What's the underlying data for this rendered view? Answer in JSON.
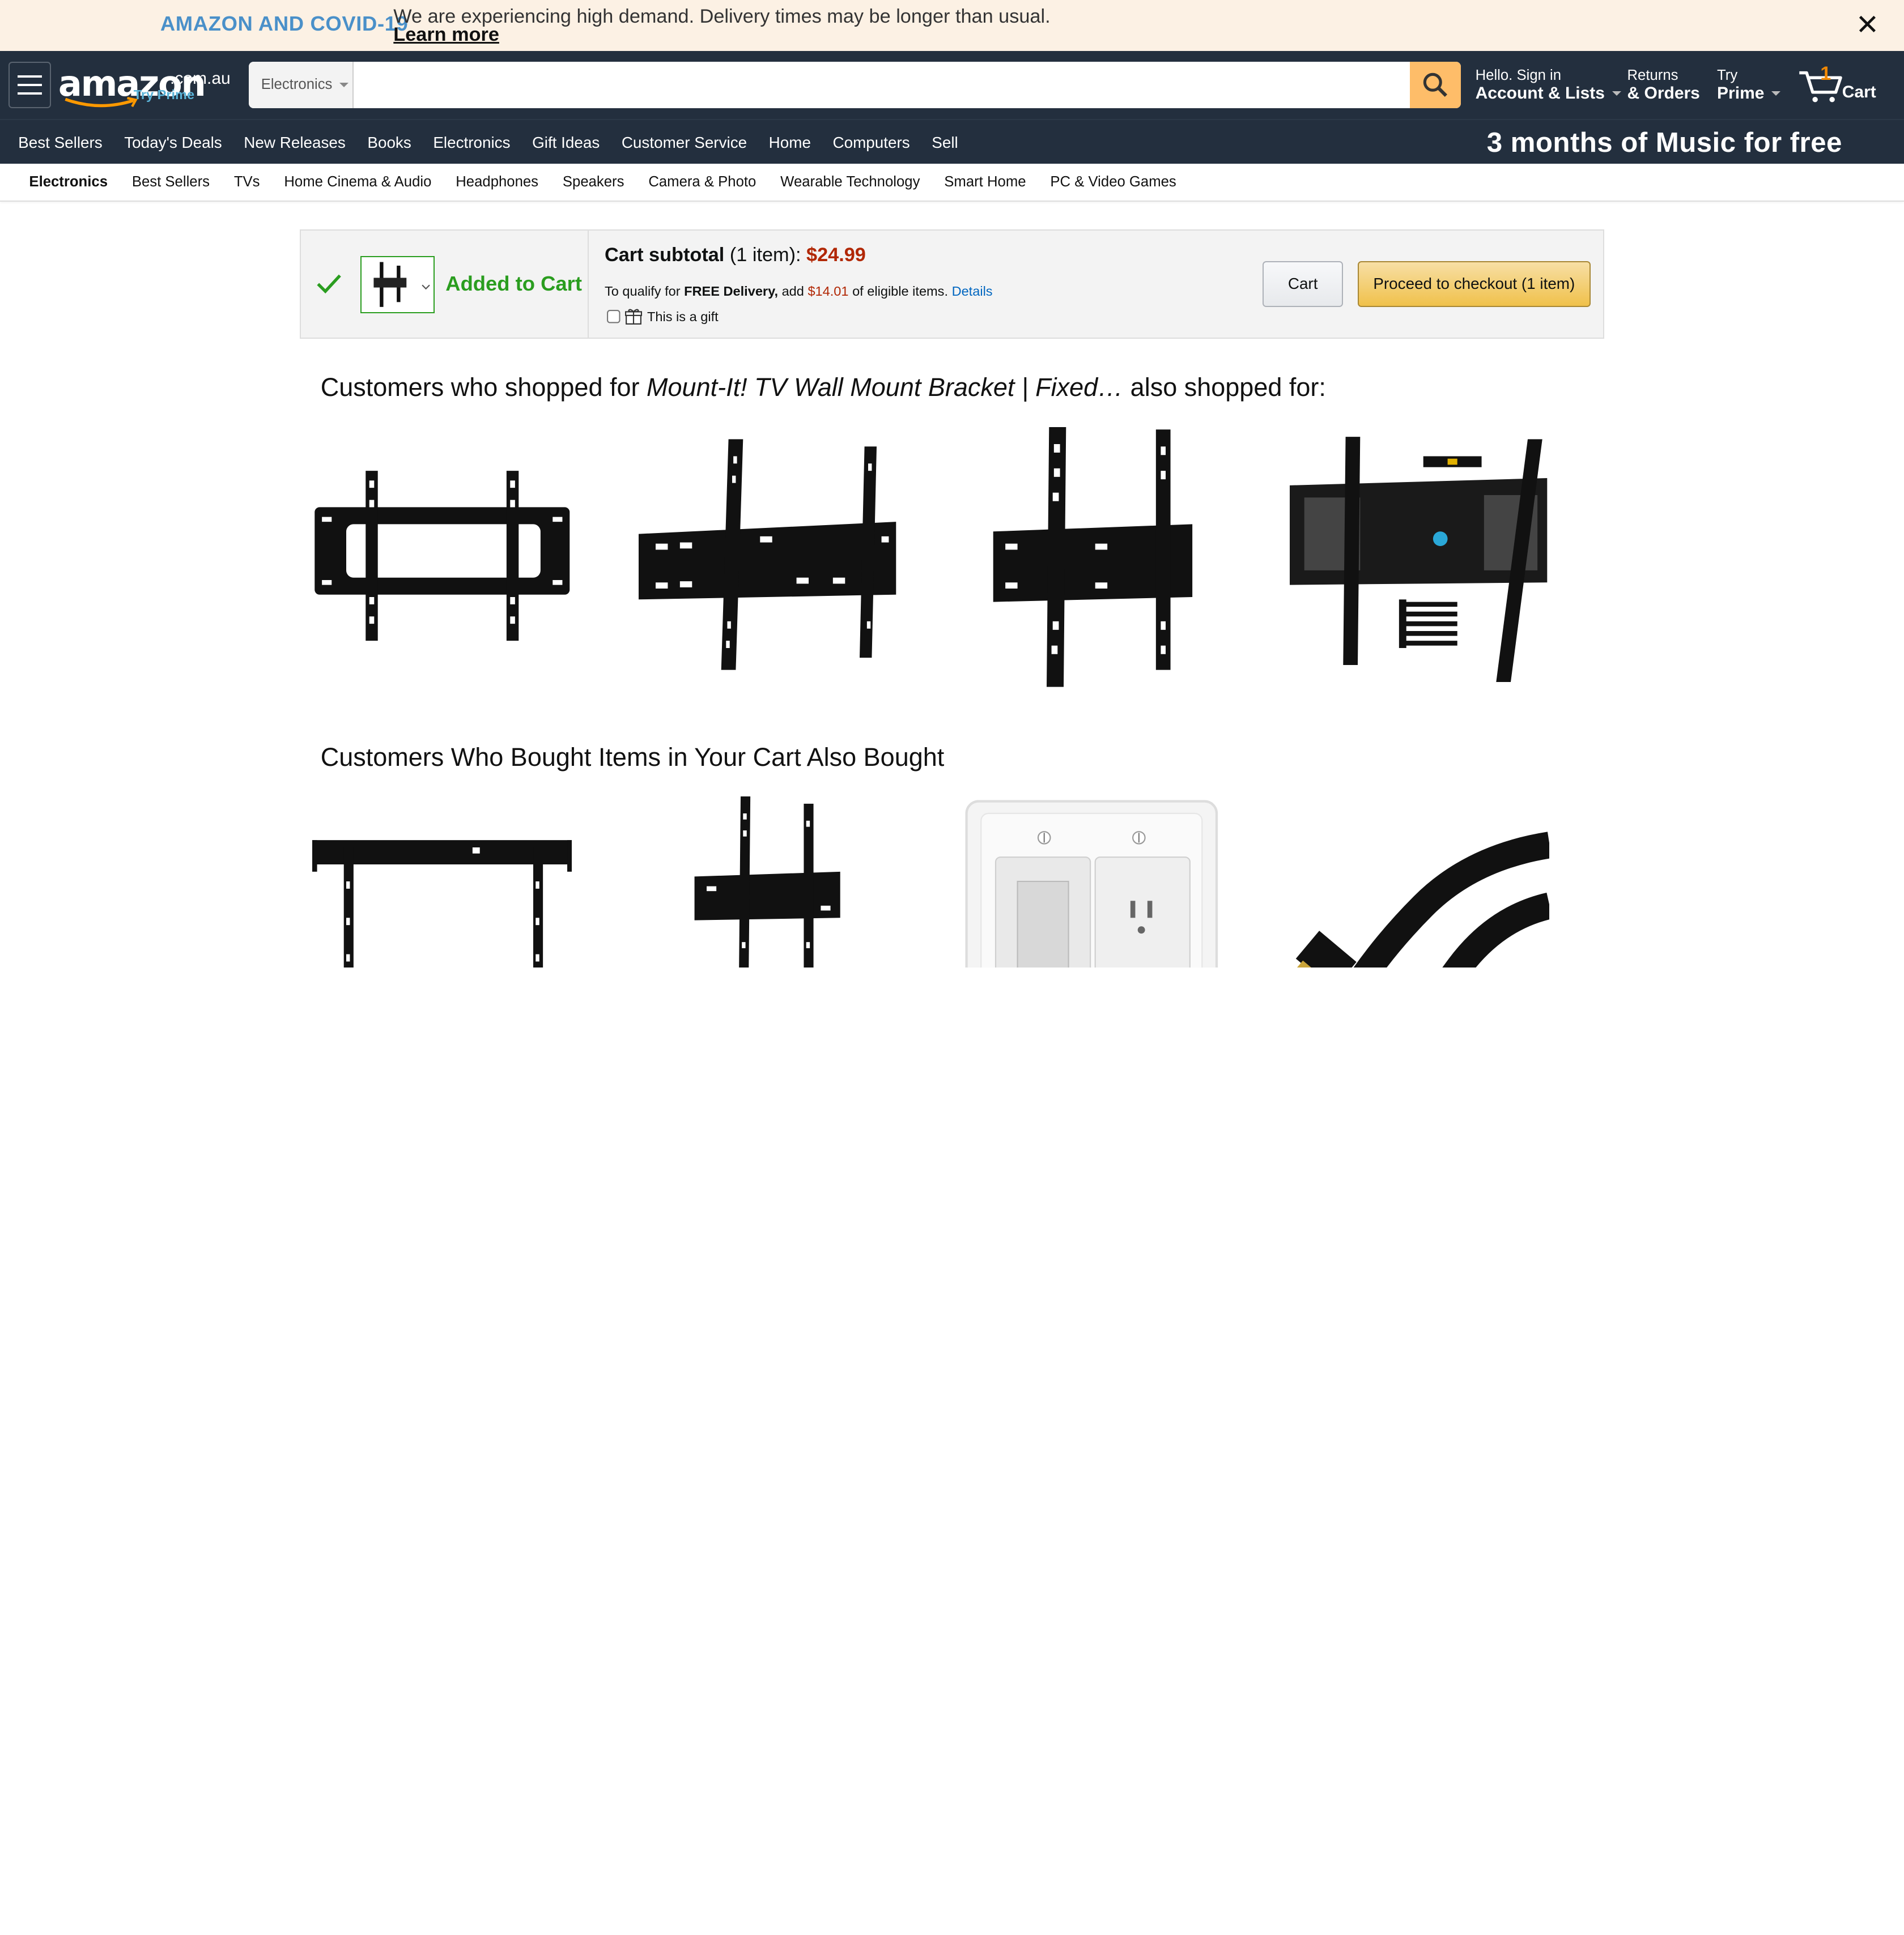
{
  "banner": {
    "title": "AMAZON AND COVID-19",
    "message": "We are experiencing high demand. Delivery times may be longer than usual.",
    "link": "Learn more"
  },
  "header": {
    "logo_word": "amazon",
    "logo_tld": ".com.au",
    "logo_prime": "Try Prime",
    "search_dept": "Electronics",
    "search_value": "",
    "account_small": "Hello. Sign in",
    "account_big": "Account & Lists",
    "returns_small": "Returns",
    "returns_big": "& Orders",
    "prime_small": "Try",
    "prime_big": "Prime",
    "cart_count": "1",
    "cart_label": "Cart"
  },
  "nav": {
    "links": [
      "Best Sellers",
      "Today's Deals",
      "New Releases",
      "Books",
      "Electronics",
      "Gift Ideas",
      "Customer Service",
      "Home",
      "Computers",
      "Sell"
    ],
    "promo": "3 months of Music for free"
  },
  "subnav": {
    "items": [
      "Electronics",
      "Best Sellers",
      "TVs",
      "Home Cinema & Audio",
      "Headphones",
      "Speakers",
      "Camera & Photo",
      "Wearable Technology",
      "Smart Home",
      "PC & Video Games"
    ]
  },
  "cart": {
    "added_label": "Added to Cart",
    "subtotal_label": "Cart subtotal",
    "subtotal_items": "(1 item):",
    "subtotal_price": "$24.99",
    "qualify_pre": "To qualify for",
    "qualify_bold": "FREE Delivery,",
    "qualify_add": "add",
    "qualify_amount": "$14.01",
    "qualify_post": "of eligible items.",
    "details_link": "Details",
    "gift_label": "This is a gift",
    "cart_button": "Cart",
    "checkout_button": "Proceed to checkout (1 item)"
  },
  "sections": {
    "shopped_pre": "Customers who shopped for",
    "shopped_item": "Mount-It! TV Wall Mount Bracket | Fixed…",
    "shopped_post": "also shopped for:",
    "bought_title": "Customers Who Bought Items in Your Cart Also Bought"
  },
  "colors": {
    "nav_bg": "#232f3e",
    "banner_bg": "#fcf1e4",
    "price": "#b12704",
    "added_green": "#2a9d1f",
    "checkout_yellow": "#f0c14b",
    "search_button": "#febd69"
  }
}
